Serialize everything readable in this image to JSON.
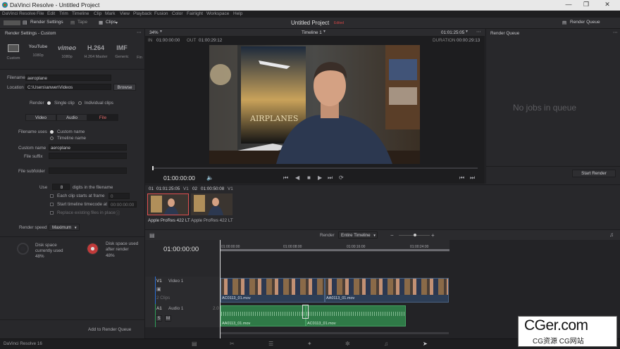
{
  "window": {
    "title": "DaVinci Resolve - Untitled Project"
  },
  "menu": [
    "DaVinci Resolve",
    "File",
    "Edit",
    "Trim",
    "Timeline",
    "Clip",
    "Mark",
    "View",
    "Playback",
    "Fusion",
    "Color",
    "Fairlight",
    "Workspace",
    "Help"
  ],
  "toolbar": {
    "render_settings": "Render Settings",
    "tape": "Tape",
    "clips": "Clips",
    "project_name": "Untitled Project",
    "edited_badge": "Edited",
    "render_queue": "Render Queue"
  },
  "render_settings": {
    "header": "Render Settings - Custom",
    "presets": [
      {
        "logo": "",
        "caption": "Custom"
      },
      {
        "logo": "YouTube",
        "caption": "1080p"
      },
      {
        "logo": "vimeo",
        "caption": "1080p"
      },
      {
        "logo": "H.264",
        "caption": "H.264 Master"
      },
      {
        "logo": "IMF",
        "caption": "Generic"
      },
      {
        "logo": "",
        "caption": "Fin"
      }
    ],
    "filename_label": "Filename",
    "filename_value": "aeroplane",
    "location_label": "Location",
    "location_value": "C:\\Users\\anwer\\Videos",
    "browse": "Browse",
    "render_label": "Render",
    "single_clip": "Single clip",
    "individual_clips": "Individual clips",
    "tabs": [
      "Video",
      "Audio",
      "File"
    ],
    "filename_uses_label": "Filename uses",
    "custom_name": "Custom name",
    "timeline_name": "Timeline name",
    "custom_name_label": "Custom name",
    "custom_name_value": "aeroplane",
    "file_suffix_label": "File suffix",
    "file_subfolder_label": "File subfolder",
    "use_label": "Use",
    "use_value": "8",
    "digits_label": "digits in the filename",
    "each_clip_label": "Each clip starts at frame",
    "each_clip_value": "0",
    "start_tc_label": "Start timeline timecode at",
    "start_tc_value": "00:00:00:00",
    "replace_label": "Replace existing files in place",
    "render_speed_label": "Render speed",
    "render_speed_value": "Maximum",
    "disk1": "Disk space currently used",
    "disk1_pct": "48%",
    "disk2": "Disk space used after render",
    "disk2_pct": "48%",
    "add_to_queue": "Add to Render Queue"
  },
  "viewer": {
    "zoom": "34%",
    "timeline_name": "Timeline 1",
    "timecode_top": "01:01:25:05",
    "in_label": "IN",
    "in_tc": "01:00:00:00",
    "out_label": "OUT",
    "out_tc": "01:00:29:12",
    "duration_label": "DURATION",
    "duration_tc": "00:00:29:13",
    "playhead_tc": "01:00:00:00"
  },
  "render_queue": {
    "title": "Render Queue",
    "empty": "No jobs in queue",
    "start_render": "Start Render"
  },
  "clips": [
    {
      "num": "01",
      "tc": "01:01:25:05",
      "track": "V1",
      "codec": "Apple ProRes 422 LT"
    },
    {
      "num": "02",
      "tc": "01:00:50:08",
      "track": "V1",
      "codec": "Apple ProRes 422 LT"
    }
  ],
  "timeline": {
    "render_label": "Render",
    "range_value": "Entire Timeline",
    "timecode": "01:00:00:00",
    "ruler": [
      "01:00:00:00",
      "01:00:08:00",
      "01:00:16:00",
      "01:00:24:00"
    ],
    "v1_label": "V1",
    "v1_name": "Video 1",
    "v1_clips": "2 Clips",
    "a1_label": "A1",
    "a1_name": "Audio 1",
    "a1_level": "2.0",
    "video_clips": [
      "AC0113_01.mov",
      "AA0113_01.mov"
    ],
    "audio_clips": [
      "AA0113_01.mov",
      "AC0113_01.mov"
    ]
  },
  "footer": {
    "version": "DaVinci Resolve 16"
  },
  "watermark": {
    "logo": "CGer.com",
    "tagline": "CG资源 CG网站"
  }
}
